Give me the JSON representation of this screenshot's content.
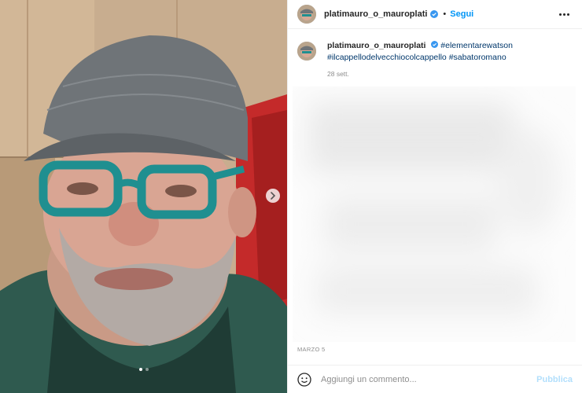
{
  "post": {
    "username": "platimauro_o_mauroplati",
    "follow_label": "Segui",
    "separator": "•",
    "caption": {
      "username": "platimauro_o_mauroplati",
      "hashtags": [
        "#elementarewatson",
        "#ilcappellodelvecchiocolcappello",
        "#sabatoromano"
      ],
      "time": "28 sett."
    },
    "date": "MARZO 5",
    "carousel": {
      "slides": 2,
      "active_index": 0
    },
    "comment": {
      "placeholder": "Aggiungi un commento...",
      "publish_label": "Pubblica"
    }
  },
  "icons": {
    "verified": "verified-badge-icon",
    "more": "more-options-icon",
    "next": "chevron-right-icon",
    "emoji": "emoji-icon"
  },
  "colors": {
    "link_blue": "#0095f6",
    "verified_blue": "#3897f0",
    "hashtag": "#00376b",
    "muted": "#8e8e8e",
    "publish_disabled": "#b2dffc"
  }
}
